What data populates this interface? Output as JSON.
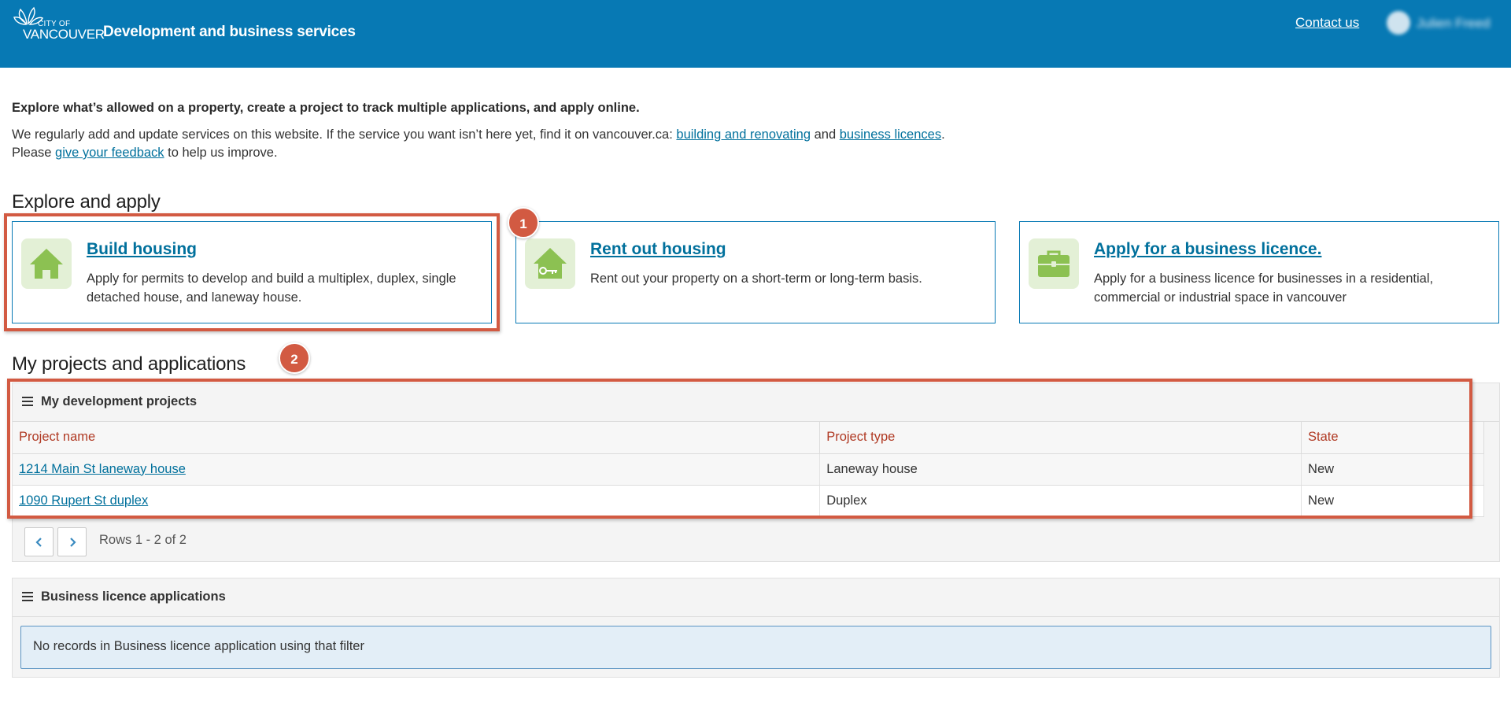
{
  "header": {
    "logo": {
      "line1": "CITY OF",
      "line2": "VANCOUVER"
    },
    "title": "Development and business services",
    "contact_label": "Contact us",
    "user_name": "Julien Freed"
  },
  "intro": {
    "lead": "Explore what’s allowed on a property, create a project to track multiple applications, and apply online.",
    "body_prefix": "We regularly add and update services on this website. If the service you want isn’t here yet, find it on vancouver.ca: ",
    "link_building": "building and renovating",
    "body_and": " and ",
    "link_business": "business licences",
    "body_please": ". Please ",
    "link_feedback": "give your feedback",
    "body_suffix": " to help us improve."
  },
  "explore": {
    "heading": "Explore and apply",
    "cards": [
      {
        "title": "Build housing",
        "description": "Apply for permits to develop and build a multiplex, duplex, single detached house, and laneway house.",
        "icon": "house-icon"
      },
      {
        "title": "Rent out housing",
        "description": "Rent out your property on a short-term or long-term basis.",
        "icon": "house-key-icon"
      },
      {
        "title": "Apply for a business licence.",
        "description": "Apply for a business licence for businesses in a residential, commercial or industrial space in vancouver",
        "icon": "briefcase-icon"
      }
    ]
  },
  "projects": {
    "heading": "My projects and applications",
    "dev_panel": {
      "title": "My development projects",
      "columns": [
        "Project name",
        "Project type",
        "State"
      ],
      "rows": [
        {
          "name": "1214 Main St laneway house",
          "type": "Laneway house",
          "state": "New"
        },
        {
          "name": "1090 Rupert St duplex",
          "type": "Duplex",
          "state": "New"
        }
      ],
      "pager_info": "Rows 1 - 2 of 2"
    },
    "biz_panel": {
      "title": "Business licence applications",
      "empty_message": "No records in Business licence application using that filter"
    }
  },
  "annotations": {
    "badge1": "1",
    "badge2": "2"
  },
  "colors": {
    "header_bg": "#0779b4",
    "link": "#00709c",
    "callout": "#d25a42",
    "icon_green": "#8cc152",
    "table_header_text": "#b03a24"
  }
}
